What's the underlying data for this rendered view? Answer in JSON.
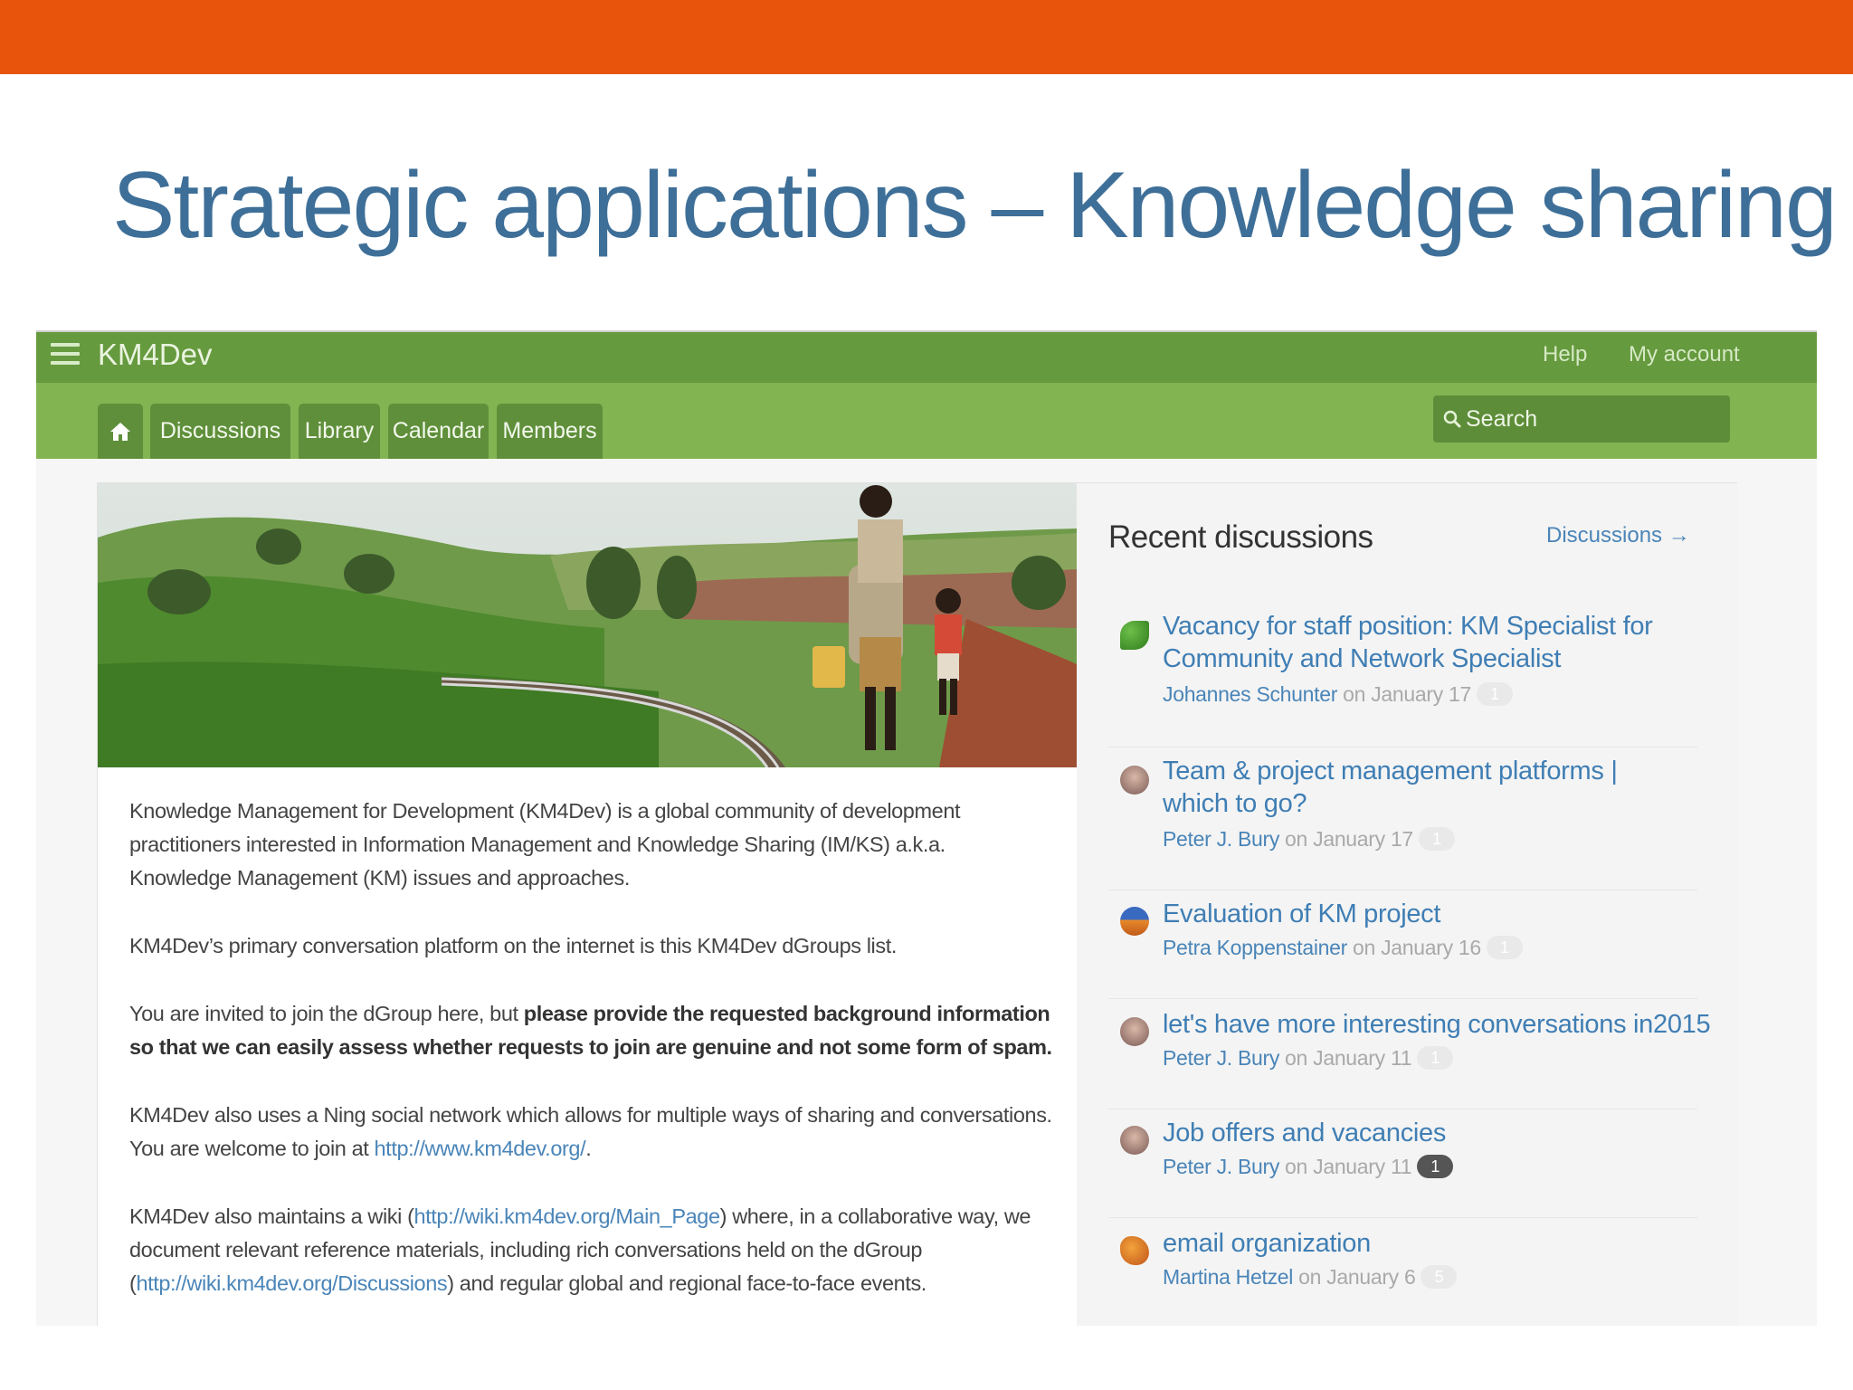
{
  "slide": {
    "title": "Strategic applications – Knowledge sharing",
    "accent_color": "#e8540c"
  },
  "app": {
    "brand": "KM4Dev",
    "top_links": [
      "Help",
      "My account"
    ],
    "nav": {
      "home_icon": "home-icon",
      "tabs": [
        "Discussions",
        "Library",
        "Calendar",
        "Members"
      ]
    },
    "search": {
      "placeholder": "Search",
      "icon": "search-icon"
    },
    "theme_colors": {
      "bar_dark": "#669a3e",
      "bar_light": "#82b552"
    }
  },
  "main": {
    "hero_image": "photo of children walking along railway through green hills",
    "paragraphs": {
      "p1": "Knowledge Management for Development (KM4Dev) is a global community of development practitioners interested in Information Management and Knowledge Sharing (IM/KS) a.k.a. Knowledge Management (KM) issues and approaches.",
      "p2": "KM4Dev’s primary conversation platform on the internet is this KM4Dev dGroups list.",
      "p3_text": "You are invited to join the dGroup here, but ",
      "p3_bold": "please provide the requested background information so that we can easily assess whether requests to join are genuine and not some form of spam.",
      "p4_text": "KM4Dev also uses a Ning social network which allows for multiple ways of sharing and conversations. You are welcome to join at ",
      "p4_link": "http://www.km4dev.org/",
      "p4_end": ".",
      "p5_a": "KM4Dev also maintains a wiki (",
      "p5_link1": "http://wiki.km4dev.org/Main_Page",
      "p5_b": ") where, in a collaborative way, we document relevant reference materials, including rich conversations held on the dGroup (",
      "p5_link2": "http://wiki.km4dev.org/Discussions",
      "p5_c": ") and regular global and regional face-to-face events."
    }
  },
  "sidebar": {
    "title": "Recent discussions",
    "link": "Discussions →",
    "on_word": "on",
    "items": [
      {
        "title": "Vacancy for staff position: KM Specialist for Community and Network Specialist",
        "author": "Johannes Schunter",
        "date": "January 17",
        "count": "1",
        "avatar": "leaf-avatar-icon"
      },
      {
        "title": "Team & project management platforms | which to go?",
        "author": "Peter J. Bury",
        "date": "January 17",
        "count": "1",
        "avatar": "person-avatar-icon"
      },
      {
        "title": "Evaluation of KM project",
        "author": "Petra Koppenstainer",
        "date": "January 16",
        "count": "1",
        "avatar": "landscape-avatar-icon"
      },
      {
        "title": "let's have more interesting conversations in2015",
        "author": "Peter J. Bury",
        "date": "January 11",
        "count": "1",
        "avatar": "person-avatar-icon"
      },
      {
        "title": "Job offers and vacancies",
        "author": "Peter J. Bury",
        "date": "January 11",
        "count": "1",
        "avatar": "person-avatar-icon"
      },
      {
        "title": "email organization",
        "author": "Martina Hetzel",
        "date": "January 6",
        "count": "5",
        "avatar": "autumn-leaf-avatar-icon"
      }
    ]
  }
}
